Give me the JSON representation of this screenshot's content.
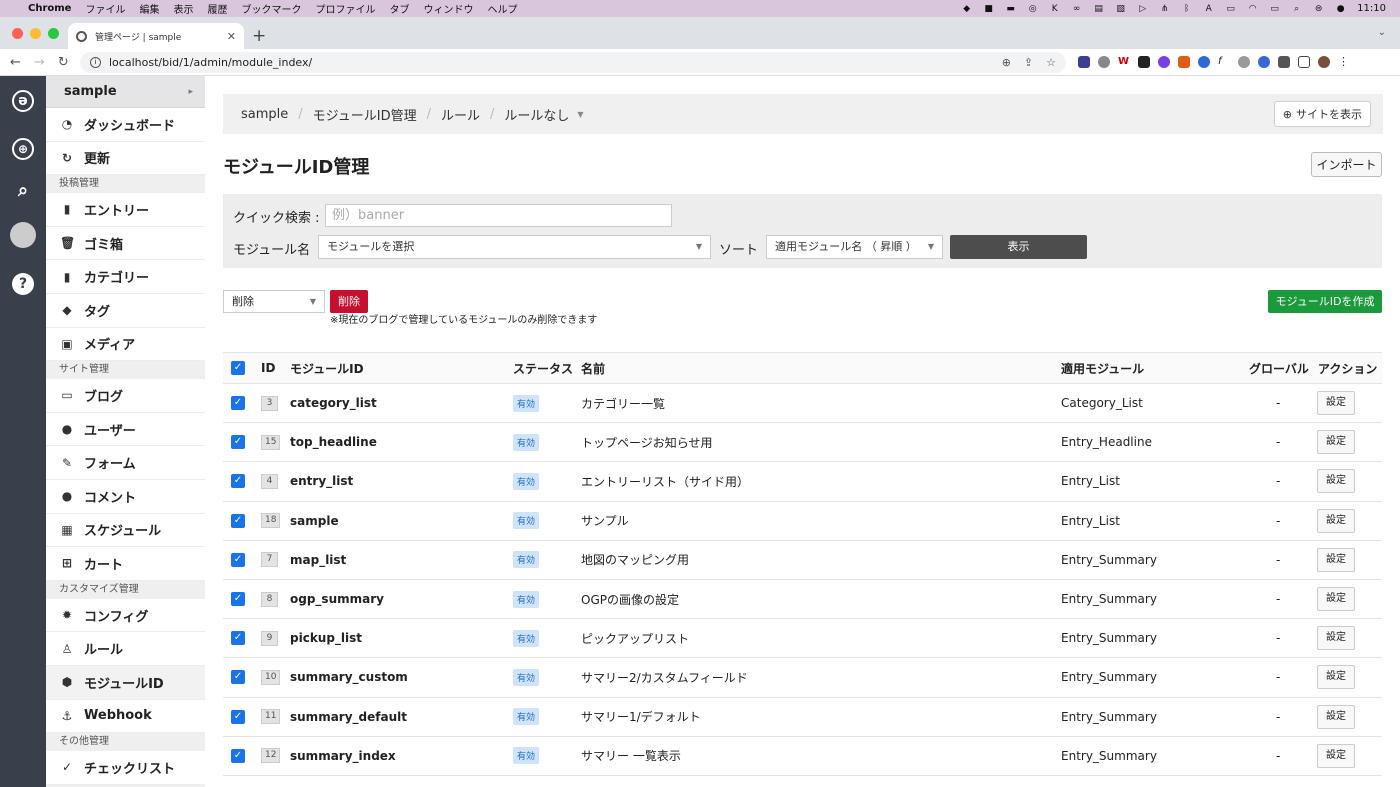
{
  "menubar": {
    "app": "Chrome",
    "items": [
      "ファイル",
      "編集",
      "表示",
      "履歴",
      "ブックマーク",
      "プロファイル",
      "タブ",
      "ウィンドウ",
      "ヘルプ"
    ],
    "clock": "11:10"
  },
  "browser": {
    "tab_title": "管理ページ | sample",
    "url": "localhost/bid/1/admin/module_index/"
  },
  "sidebar": {
    "site_name": "sample",
    "groups": [
      {
        "section": "",
        "items": [
          {
            "icon": "dashboard-icon",
            "glyph": "◔",
            "label": "ダッシュボード"
          },
          {
            "icon": "refresh-icon",
            "glyph": "↻",
            "label": "更新"
          }
        ]
      },
      {
        "section": "投稿管理",
        "items": [
          {
            "icon": "entry-icon",
            "glyph": "▮",
            "label": "エントリー"
          },
          {
            "icon": "trash-icon",
            "glyph": "🗑",
            "label": "ゴミ箱"
          },
          {
            "icon": "category-icon",
            "glyph": "▮",
            "label": "カテゴリー"
          },
          {
            "icon": "tag-icon",
            "glyph": "◆",
            "label": "タグ"
          },
          {
            "icon": "media-icon",
            "glyph": "▣",
            "label": "メディア"
          }
        ]
      },
      {
        "section": "サイト管理",
        "items": [
          {
            "icon": "blog-icon",
            "glyph": "▭",
            "label": "ブログ"
          },
          {
            "icon": "user-icon",
            "glyph": "●",
            "label": "ユーザー"
          },
          {
            "icon": "form-icon",
            "glyph": "✎",
            "label": "フォーム"
          },
          {
            "icon": "comment-icon",
            "glyph": "●",
            "label": "コメント"
          },
          {
            "icon": "calendar-icon",
            "glyph": "▦",
            "label": "スケジュール"
          },
          {
            "icon": "cart-icon",
            "glyph": "⊞",
            "label": "カート"
          }
        ]
      },
      {
        "section": "カスタマイズ管理",
        "items": [
          {
            "icon": "config-icon",
            "glyph": "✹",
            "label": "コンフィグ"
          },
          {
            "icon": "rule-icon",
            "glyph": "♙",
            "label": "ルール"
          },
          {
            "icon": "module-icon",
            "glyph": "⬢",
            "label": "モジュールID",
            "active": true
          },
          {
            "icon": "webhook-icon",
            "glyph": "⚓",
            "label": "Webhook"
          }
        ]
      },
      {
        "section": "その他管理",
        "items": [
          {
            "icon": "checklist-icon",
            "glyph": "✓",
            "label": "チェックリスト"
          }
        ]
      }
    ]
  },
  "breadcrumb": [
    "sample",
    "モジュールID管理",
    "ルール",
    "ルールなし"
  ],
  "view_site_label": "サイトを表示",
  "page_title": "モジュールID管理",
  "import_label": "インポート",
  "filter": {
    "quick_search_label": "クイック検索 :",
    "quick_search_placeholder": "例）banner",
    "module_label": "モジュール名",
    "module_value": "モジュールを選択",
    "sort_label": "ソート",
    "sort_value": "適用モジュール名 （ 昇順 ）",
    "show_label": "表示"
  },
  "bulk": {
    "select_value": "削除",
    "button_label": "削除",
    "note": "※現在のブログで管理しているモジュールのみ削除できます"
  },
  "create_label": "モジュールIDを作成",
  "table": {
    "headers": {
      "id": "ID",
      "module_id": "モジュールID",
      "status": "ステータス",
      "name": "名前",
      "module": "適用モジュール",
      "global": "グローバル",
      "action": "アクション"
    },
    "rows": [
      {
        "id": "3",
        "module_id": "category_list",
        "status": "有効",
        "name": "カテゴリー一覧",
        "module": "Category_List",
        "global": "-",
        "action": "設定"
      },
      {
        "id": "15",
        "module_id": "top_headline",
        "status": "有効",
        "name": "トップページお知らせ用",
        "module": "Entry_Headline",
        "global": "-",
        "action": "設定"
      },
      {
        "id": "4",
        "module_id": "entry_list",
        "status": "有効",
        "name": "エントリーリスト（サイド用）",
        "module": "Entry_List",
        "global": "-",
        "action": "設定"
      },
      {
        "id": "18",
        "module_id": "sample",
        "status": "有効",
        "name": "サンプル",
        "module": "Entry_List",
        "global": "-",
        "action": "設定"
      },
      {
        "id": "7",
        "module_id": "map_list",
        "status": "有効",
        "name": "地図のマッピング用",
        "module": "Entry_Summary",
        "global": "-",
        "action": "設定"
      },
      {
        "id": "8",
        "module_id": "ogp_summary",
        "status": "有効",
        "name": "OGPの画像の設定",
        "module": "Entry_Summary",
        "global": "-",
        "action": "設定"
      },
      {
        "id": "9",
        "module_id": "pickup_list",
        "status": "有効",
        "name": "ピックアップリスト",
        "module": "Entry_Summary",
        "global": "-",
        "action": "設定"
      },
      {
        "id": "10",
        "module_id": "summary_custom",
        "status": "有効",
        "name": "サマリー2/カスタムフィールド",
        "module": "Entry_Summary",
        "global": "-",
        "action": "設定"
      },
      {
        "id": "11",
        "module_id": "summary_default",
        "status": "有効",
        "name": "サマリー1/デフォルト",
        "module": "Entry_Summary",
        "global": "-",
        "action": "設定"
      },
      {
        "id": "12",
        "module_id": "summary_index",
        "status": "有効",
        "name": "サマリー 一覧表示",
        "module": "Entry_Summary",
        "global": "-",
        "action": "設定"
      }
    ]
  }
}
